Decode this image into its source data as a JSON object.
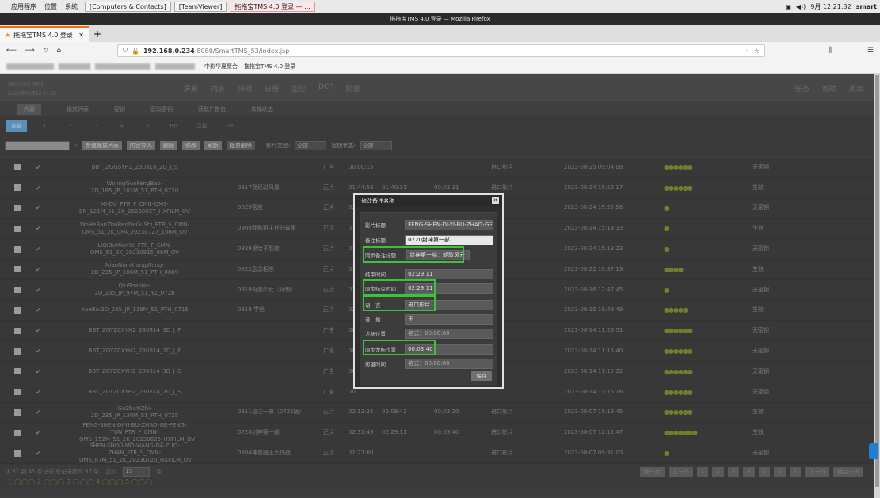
{
  "os_bar": {
    "apps": "应用程序",
    "places": "位置",
    "system": "系统",
    "tasks": [
      "[Computers & Contacts]",
      "[TeamViewer]",
      "拖拖宝TMS 4.0 登录 — ..."
    ],
    "clock": "9月 12 21:32",
    "user": "smart"
  },
  "window": {
    "title": "拖拖宝TMS 4.0 登录 — Mozilla Firefox"
  },
  "browser": {
    "tab_title": "拖拖宝TMS 4.0 登录",
    "url_host": "192.168.0.234",
    "url_rest": ":8080/SmartTMS_53/index.jsp",
    "more": "···",
    "bookmarks": [
      "中影华夏聚合",
      "拖拖宝TMS 4.0 登录"
    ]
  },
  "app": {
    "logo": "Bosscom",
    "date": "2023年09月12 21:32",
    "menu": [
      "屏幕",
      "内容",
      "排期",
      "日程",
      "监控",
      "DCP",
      "配置"
    ],
    "right": [
      "任务",
      "帮助",
      "退出"
    ],
    "subtabs": [
      "内容",
      "播放列表",
      "密钥",
      "获取密钥",
      "获取广告包",
      "传输状态"
    ],
    "filters": [
      "全部",
      "1",
      "2",
      "3",
      "4",
      "5",
      "Rp",
      "卫星",
      "HY"
    ],
    "tools": [
      "新建播放列表",
      "内容导入",
      "删除",
      "修改",
      "刷新",
      "批量删除"
    ],
    "film_type_label": "影片类型:",
    "film_type_val": "全部",
    "key_state_label": "密钥状态:",
    "key_state_val": "全部"
  },
  "rows": [
    {
      "title": "BBT_ZGGSYH2_230818_2D_J_S",
      "note": "",
      "type": "广告",
      "dur": "00:00:15",
      "t2": "",
      "t3": "",
      "src": "进口影片",
      "date": "2023-08-25 09:04:08",
      "badge": "●●●●●●",
      "key": "无密钥"
    },
    {
      "title": "WoJingGuoFengBao-2D_185_JP_101M_51_PTH_0720",
      "note": "0817我经过风暴",
      "type": "正片",
      "dur": "01:44:56",
      "t2": "01:40:31",
      "t3": "00:03:31",
      "src": "进口影片",
      "date": "2023-08-24 15:52:17",
      "badge": "●●●●●●",
      "key": "生效"
    },
    {
      "title": "MI-DU_FTR_F_CMN-QMS-EN_121M_51_2K_20230627_HXFILM_OV",
      "note": "0829密度",
      "type": "正片",
      "dur": "02",
      "t2": "",
      "t3": "",
      "src": "",
      "date": "2023-08-24 15:25:56",
      "badge": "●",
      "key": "无密钥"
    },
    {
      "title": "WoHeBanZhuRenDeGuShi_FTR_S_CMN-QMS_51_2K_CFA_20230727_106M_OV",
      "note": "0909我和班主任的故事",
      "type": "正片",
      "dur": "01",
      "t2": "",
      "t3": "",
      "src": "",
      "date": "2023-08-24 15:13:33",
      "badge": "●",
      "key": "生效"
    },
    {
      "title": "LiQiBuMianYe_FTR_F_CMN-QMS_51_2K_20230815_96M_OV",
      "note": "0829里给不能夜",
      "type": "正片",
      "dur": "01",
      "t2": "",
      "t3": "",
      "src": "",
      "date": "2023-08-24 15:13:23",
      "badge": "●",
      "key": "无密钥"
    },
    {
      "title": "NianNianXiangWang-2D_235_JP_106M_51_PTH_0809",
      "note": "0822念念相忘",
      "type": "正片",
      "dur": "01",
      "t2": "",
      "t3": "",
      "src": "",
      "date": "2023-08-22 10:37:19",
      "badge": "●●●●",
      "key": "生效"
    },
    {
      "title": "QiuShaoNv-2D_235_JP_97M_51_YZ_0728",
      "note": "0818奇迹少女（译制）",
      "type": "正片",
      "dur": "01",
      "t2": "",
      "t3": "",
      "src": "",
      "date": "2023-08-16 12:47:45",
      "badge": "●",
      "key": "无密钥"
    },
    {
      "title": "XueBa-2D_235_JP_119M_51_PTH_0716",
      "note": "0818 学爸",
      "type": "正片",
      "dur": "02",
      "t2": "",
      "t3": "",
      "src": "",
      "date": "2023-08-15 19:49:49",
      "badge": "●●●●●",
      "key": "生效"
    },
    {
      "title": "BBT_ZGYZCXYH2_230814_3D_J_F",
      "note": "",
      "type": "广告",
      "dur": "00",
      "t2": "",
      "t3": "",
      "src": "",
      "date": "2023-08-14 11:29:51",
      "badge": "●●●●●●",
      "key": "无密钥"
    },
    {
      "title": "BBT_ZGYZCXYH2_230814_2D_J_F",
      "note": "",
      "type": "广告",
      "dur": "00",
      "t2": "",
      "t3": "",
      "src": "",
      "date": "2023-08-14 11:15:40",
      "badge": "●●●●●●",
      "key": "无密钥"
    },
    {
      "title": "BBT_ZGYZCXYH2_230814_3D_J_S",
      "note": "",
      "type": "广告",
      "dur": "00",
      "t2": "",
      "t3": "",
      "src": "",
      "date": "2023-08-14 11:15:22",
      "badge": "●●●●●●",
      "key": "无密钥"
    },
    {
      "title": "BBT_ZGYZCXYH2_230814_2D_J_S",
      "note": "",
      "type": "广告",
      "dur": "00",
      "t2": "",
      "t3": "",
      "src": "",
      "date": "2023-08-14 11:15:16",
      "badge": "●●●●●●",
      "key": "无密钥"
    },
    {
      "title": "GuZhuYiZhi-2D_235_JP_130M_51_PTH_0725",
      "note": "0811孤注一掷（0725版）",
      "type": "正片",
      "dur": "02:13:24",
      "t2": "02:08:43",
      "t3": "00:03:20",
      "src": "进口影片",
      "date": "2023-08-07 15:16:45",
      "badge": "●●●●●●",
      "key": "生效"
    },
    {
      "title": "FENG-SHEN-DI-YI-BU-ZHAO-GE-FENG-YUN_FTR_F_CMN-QMS_152M_51_2K_20230626_HXFILM_OV",
      "note": "0720封神第一部",
      "type": "正片",
      "dur": "02:31:49",
      "t2": "02:29:11",
      "t3": "00:03:40",
      "src": "进口影片",
      "date": "2023-08-07 12:12:47",
      "badge": "●●●●●●●",
      "key": "生效"
    },
    {
      "title": "SHEN-SHOU-MO-WANG-DA-ZUO-ZHAN_FTR_S_CMN-QMS_87M_51_2K_20230720_HXFILM_OV",
      "note": "0804神兽魔王大作战",
      "type": "正片",
      "dur": "01:27:00",
      "t2": "",
      "t3": "",
      "src": "进口影片",
      "date": "2023-08-07 09:31:03",
      "badge": "●",
      "key": "无密钥"
    }
  ],
  "footer": {
    "info": "从 31 到 45 条记录 总记录数为 97 条",
    "show": "显示",
    "per": "15",
    "unit": "条",
    "pages": [
      "第一页",
      "上一页",
      "1",
      "2",
      "3",
      "4",
      "5",
      "6",
      "7",
      "下一页",
      "最后一页"
    ]
  },
  "status_dots": "1 ◯◯◯ 2 ◯◯◯ 3 ◯◯◯ 4 ◯◯◯ 5 ◯◯◯",
  "modal": {
    "title": "修改备注名称",
    "fields": [
      {
        "label": "影片标题",
        "value": "FENG-SHEN-DI-YI-BU-ZHAO-GE"
      },
      {
        "label": "备注标题",
        "value": "0720封神第一部"
      },
      {
        "label": "同步备注标题",
        "value": "封神第一部：朝歌风云"
      },
      {
        "label": "结束时间",
        "value": "02:29:11"
      },
      {
        "label": "同步结束时间",
        "value": "02:29:11"
      },
      {
        "label": "语　言",
        "value": "进口影片"
      },
      {
        "label": "音　量",
        "value": "无"
      },
      {
        "label": "龙标位置",
        "value": "格式：00:00:00"
      },
      {
        "label": "同步龙标位置",
        "value": "00:03:40"
      },
      {
        "label": "彩蛋时间",
        "value": "格式：00:00:00"
      }
    ],
    "save": "保存"
  }
}
